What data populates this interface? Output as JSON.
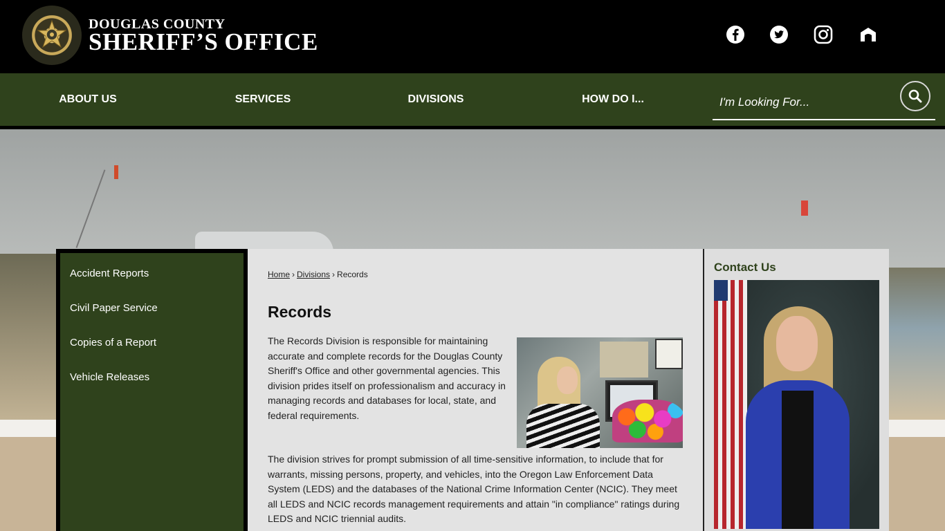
{
  "header": {
    "logo_alt": "Douglas County Sheriff's Office badge",
    "site_name_line1": "DOUGLAS COUNTY",
    "site_name_line2": "SHERIFF’S OFFICE",
    "social": [
      {
        "name": "facebook-icon"
      },
      {
        "name": "twitter-icon"
      },
      {
        "name": "instagram-icon"
      },
      {
        "name": "nextdoor-icon"
      }
    ]
  },
  "nav": {
    "items": [
      "ABOUT US",
      "SERVICES",
      "DIVISIONS",
      "HOW DO I..."
    ],
    "search_placeholder": "I'm Looking For..."
  },
  "sidebar": {
    "items": [
      "Accident Reports",
      "Civil Paper Service",
      "Copies of a Report",
      "Vehicle Releases"
    ]
  },
  "main": {
    "breadcrumb": [
      "Home",
      "Divisions",
      "Records"
    ],
    "breadcrumb_sep": "›",
    "title": "Records",
    "para1": "The Records Division is responsible for maintaining accurate and complete records for the Douglas County Sheriff's Office and other governmental agencies. This division prides itself on professionalism and accuracy in managing records and databases for local, state, and federal requirements.",
    "para2": "The division strives for prompt submission of all time-sensitive information, to include that for warrants, missing persons, property, and vehicles, into the Oregon Law Enforcement Data System (LEDS) and the databases of the National Crime Information Center (NCIC). They meet all LEDS and NCIC records management requirements and attain \"in compliance\" ratings during LEDS and NCIC triennial audits."
  },
  "right": {
    "title": "Contact Us"
  },
  "colors": {
    "nav_green": "#2f421c",
    "header_black": "#000000",
    "content_gray": "#e3e3e3",
    "tan": "#c8b497"
  }
}
